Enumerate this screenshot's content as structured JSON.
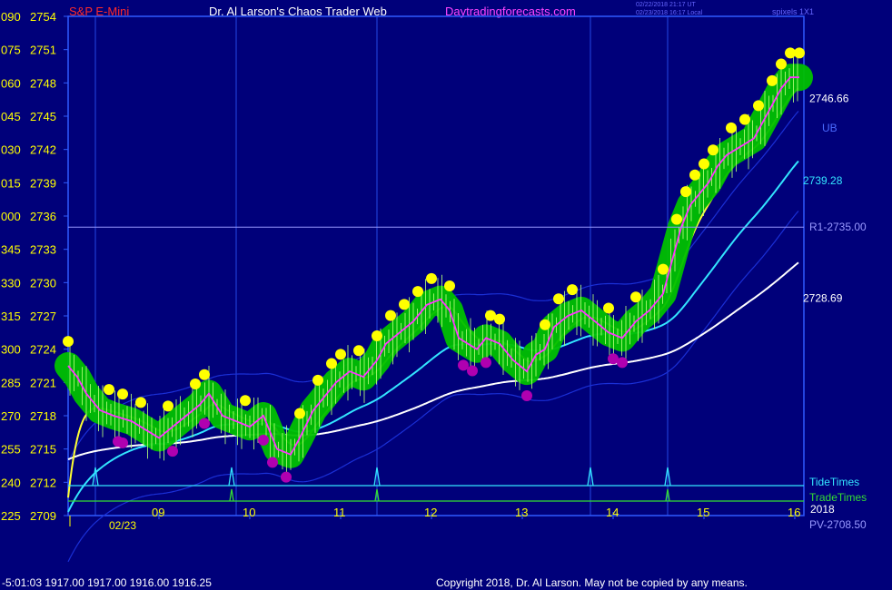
{
  "header": {
    "symbol": "S&P E-Mini",
    "title": "Dr. Al Larson's Chaos Trader Web",
    "site": "Daytradingforecasts.com",
    "timestamp1": "02/22/2018 21:17 UT",
    "timestamp2": "02/23/2018 16:17 Local",
    "pixels": "spixels 1X1"
  },
  "footer": {
    "quote": "-5:01:03  1917.00 1917.00 1916.00 1916.25",
    "copyright": "Copyright 2018, Dr. Al Larson. May not be copied by any means."
  },
  "colors": {
    "background": "#00007a",
    "axis": "#2f5bff",
    "price": "#ffff00",
    "green_glow": "#00c000",
    "yellow_sphere": "#ffff00",
    "magenta_sphere": "#b000b0",
    "ma_fast": "#ffff33",
    "ma_mid": "#33e5ff",
    "ma_slow": "#ffffff",
    "band": "#1a2fd6",
    "tide": "#33e5ff",
    "trade": "#33dd33",
    "r1": "#9999ff",
    "date": "#ffff00"
  },
  "chart_data": {
    "type": "line",
    "y_ticks": [
      {
        "angle": "090",
        "price": 2754
      },
      {
        "angle": "075",
        "price": 2751
      },
      {
        "angle": "060",
        "price": 2748
      },
      {
        "angle": "045",
        "price": 2745
      },
      {
        "angle": "030",
        "price": 2742
      },
      {
        "angle": "015",
        "price": 2739
      },
      {
        "angle": "000",
        "price": 2736
      },
      {
        "angle": "345",
        "price": 2733
      },
      {
        "angle": "330",
        "price": 2730
      },
      {
        "angle": "315",
        "price": 2727
      },
      {
        "angle": "300",
        "price": 2724
      },
      {
        "angle": "285",
        "price": 2721
      },
      {
        "angle": "270",
        "price": 2718
      },
      {
        "angle": "255",
        "price": 2715
      },
      {
        "angle": "240",
        "price": 2712
      },
      {
        "angle": "225",
        "price": 2709
      }
    ],
    "ylim": [
      2709,
      2754
    ],
    "xlim": [
      8,
      16.1
    ],
    "x_ticks": [
      9,
      10,
      11,
      12,
      13,
      14,
      15,
      16
    ],
    "x_tick_labels": [
      "09",
      "10",
      "11",
      "12",
      "13",
      "14",
      "15",
      "16"
    ],
    "date_label": "02/23",
    "date_x": 8.45,
    "verticals": [
      8.3,
      9.85,
      11.4,
      13.75,
      14.6
    ],
    "tide_times": [
      8.3,
      9.8,
      11.4,
      13.75,
      14.6
    ],
    "trade_times": [
      9.8,
      11.4,
      14.6
    ],
    "tide_label": "TideTimes",
    "trade_label": "TradeTimes",
    "trade_year": "2018",
    "levels": [
      {
        "label": "R1-2735.00",
        "value": 2735.0
      },
      {
        "label": "PV-2708.50",
        "value": 2708.5
      }
    ],
    "value_labels": [
      {
        "label": "2746.66",
        "value": 2746.66
      },
      {
        "label": "2739.28",
        "value": 2739.28
      },
      {
        "label": "2728.69",
        "value": 2728.69
      }
    ],
    "ub_label": "UB",
    "price": {
      "x": [
        8,
        8.1,
        8.2,
        8.35,
        8.5,
        8.7,
        8.9,
        9.0,
        9.15,
        9.3,
        9.45,
        9.55,
        9.7,
        9.85,
        10.0,
        10.15,
        10.3,
        10.45,
        10.55,
        10.7,
        10.85,
        10.95,
        11.1,
        11.25,
        11.4,
        11.5,
        11.65,
        11.8,
        11.95,
        12.1,
        12.2,
        12.3,
        12.4,
        12.5,
        12.6,
        12.75,
        12.9,
        13.05,
        13.15,
        13.25,
        13.35,
        13.5,
        13.65,
        13.8,
        13.95,
        14.1,
        14.25,
        14.4,
        14.55,
        14.65,
        14.75,
        14.85,
        14.95,
        15.05,
        15.15,
        15.25,
        15.35,
        15.45,
        15.55,
        15.65,
        15.75,
        15.85,
        15.95,
        16.05
      ],
      "y": [
        2722.5,
        2721.5,
        2720,
        2718.5,
        2718,
        2717.5,
        2716.5,
        2716,
        2717,
        2718,
        2719,
        2720,
        2718,
        2717.5,
        2717,
        2718,
        2715,
        2714.5,
        2716,
        2718.5,
        2720,
        2721,
        2722,
        2721.5,
        2723,
        2724.5,
        2725.5,
        2726.5,
        2728,
        2728.5,
        2727.5,
        2725,
        2724.5,
        2724,
        2725,
        2724.5,
        2723,
        2722,
        2723.5,
        2724,
        2726,
        2727,
        2727.5,
        2726.5,
        2725.5,
        2725,
        2726.5,
        2727.5,
        2729,
        2732,
        2735,
        2737,
        2738,
        2739,
        2740.5,
        2741.5,
        2742,
        2742.5,
        2743,
        2744.5,
        2746,
        2747.5,
        2748.5,
        2748.5
      ]
    },
    "yellow_spheres_x": [
      8.0,
      8.45,
      8.6,
      8.8,
      9.1,
      9.4,
      9.5,
      9.95,
      10.55,
      10.75,
      10.9,
      11.0,
      11.2,
      11.4,
      11.55,
      11.7,
      11.85,
      12.0,
      12.2,
      12.65,
      12.75,
      13.25,
      13.4,
      13.55,
      13.95,
      14.25,
      14.55,
      14.7,
      14.8,
      14.9,
      15.0,
      15.1,
      15.3,
      15.45,
      15.6,
      15.75,
      15.85,
      15.95,
      16.05
    ],
    "magenta_spheres_x": [
      8.55,
      8.6,
      9.15,
      9.5,
      10.15,
      10.25,
      10.4,
      12.35,
      12.45,
      12.6,
      13.05,
      14.0,
      14.1
    ]
  }
}
